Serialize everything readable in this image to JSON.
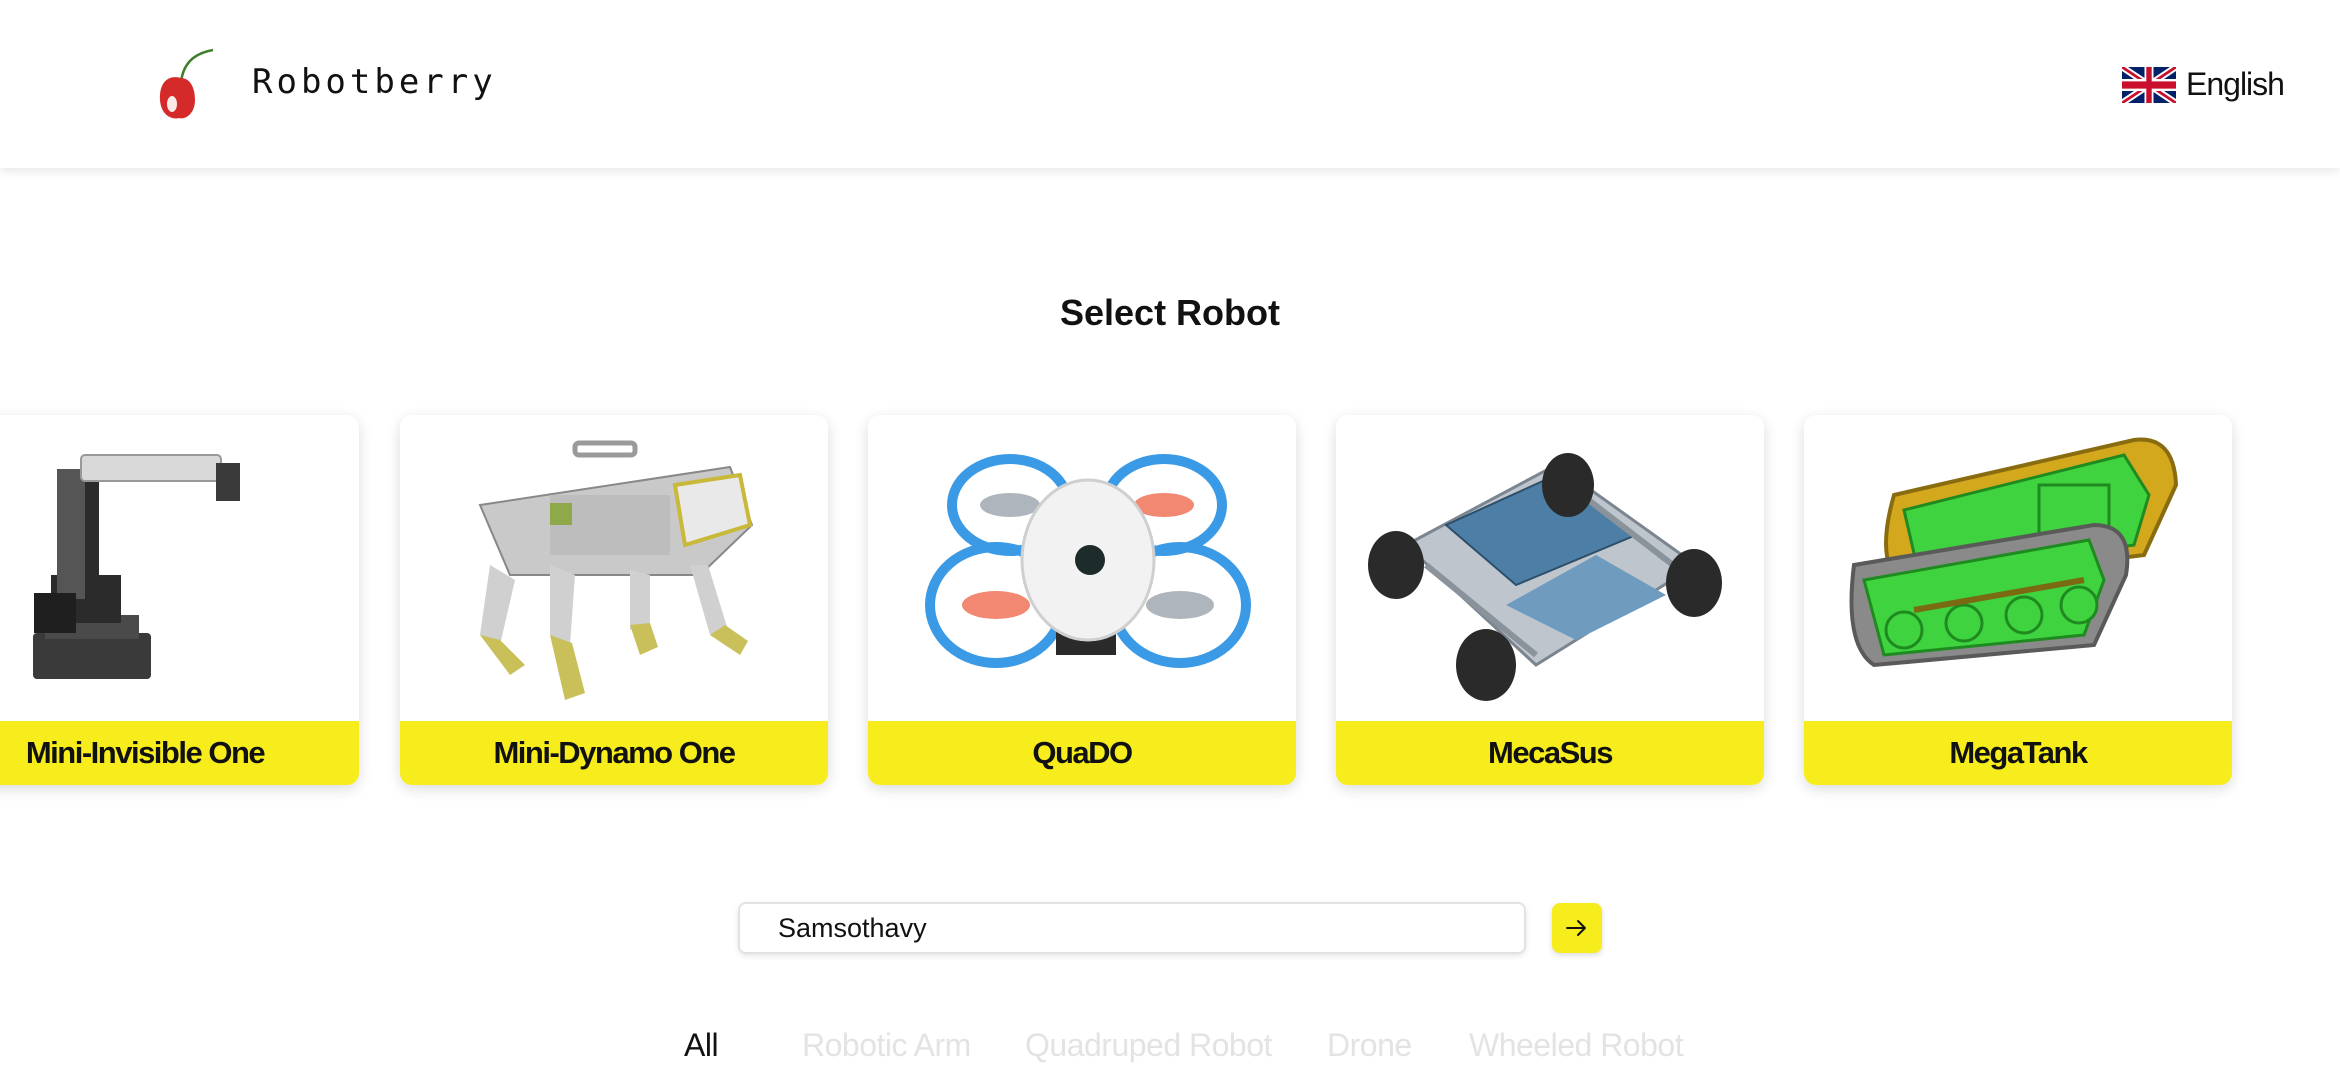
{
  "header": {
    "brand": "Robotberry",
    "language": "English",
    "icons": {
      "logo": "cherry-logo",
      "flag": "uk-flag-icon"
    },
    "colors": {
      "cherry": "#d42a2a",
      "stem": "#3f7f2a"
    }
  },
  "page": {
    "title": "Select Robot"
  },
  "robots": [
    {
      "name": "Mini-Invisible One",
      "image": "robotic-arm-image"
    },
    {
      "name": "Mini-Dynamo One",
      "image": "quadruped-robot-image"
    },
    {
      "name": "QuaDO",
      "image": "drone-image"
    },
    {
      "name": "MecaSus",
      "image": "mecanum-rover-image"
    },
    {
      "name": "MegaTank",
      "image": "tracked-tank-image"
    }
  ],
  "search": {
    "value": "Samsothavy",
    "submit_icon": "arrow-right-icon"
  },
  "filters": [
    {
      "label": "All",
      "active": true
    },
    {
      "label": "Robotic Arm",
      "active": false
    },
    {
      "label": "Quadruped Robot",
      "active": false
    },
    {
      "label": "Drone",
      "active": false
    },
    {
      "label": "Wheeled Robot",
      "active": false
    }
  ],
  "colors": {
    "accent_yellow": "#f7ec1c",
    "inactive_filter": "#e3e3e3",
    "text": "#111111"
  }
}
